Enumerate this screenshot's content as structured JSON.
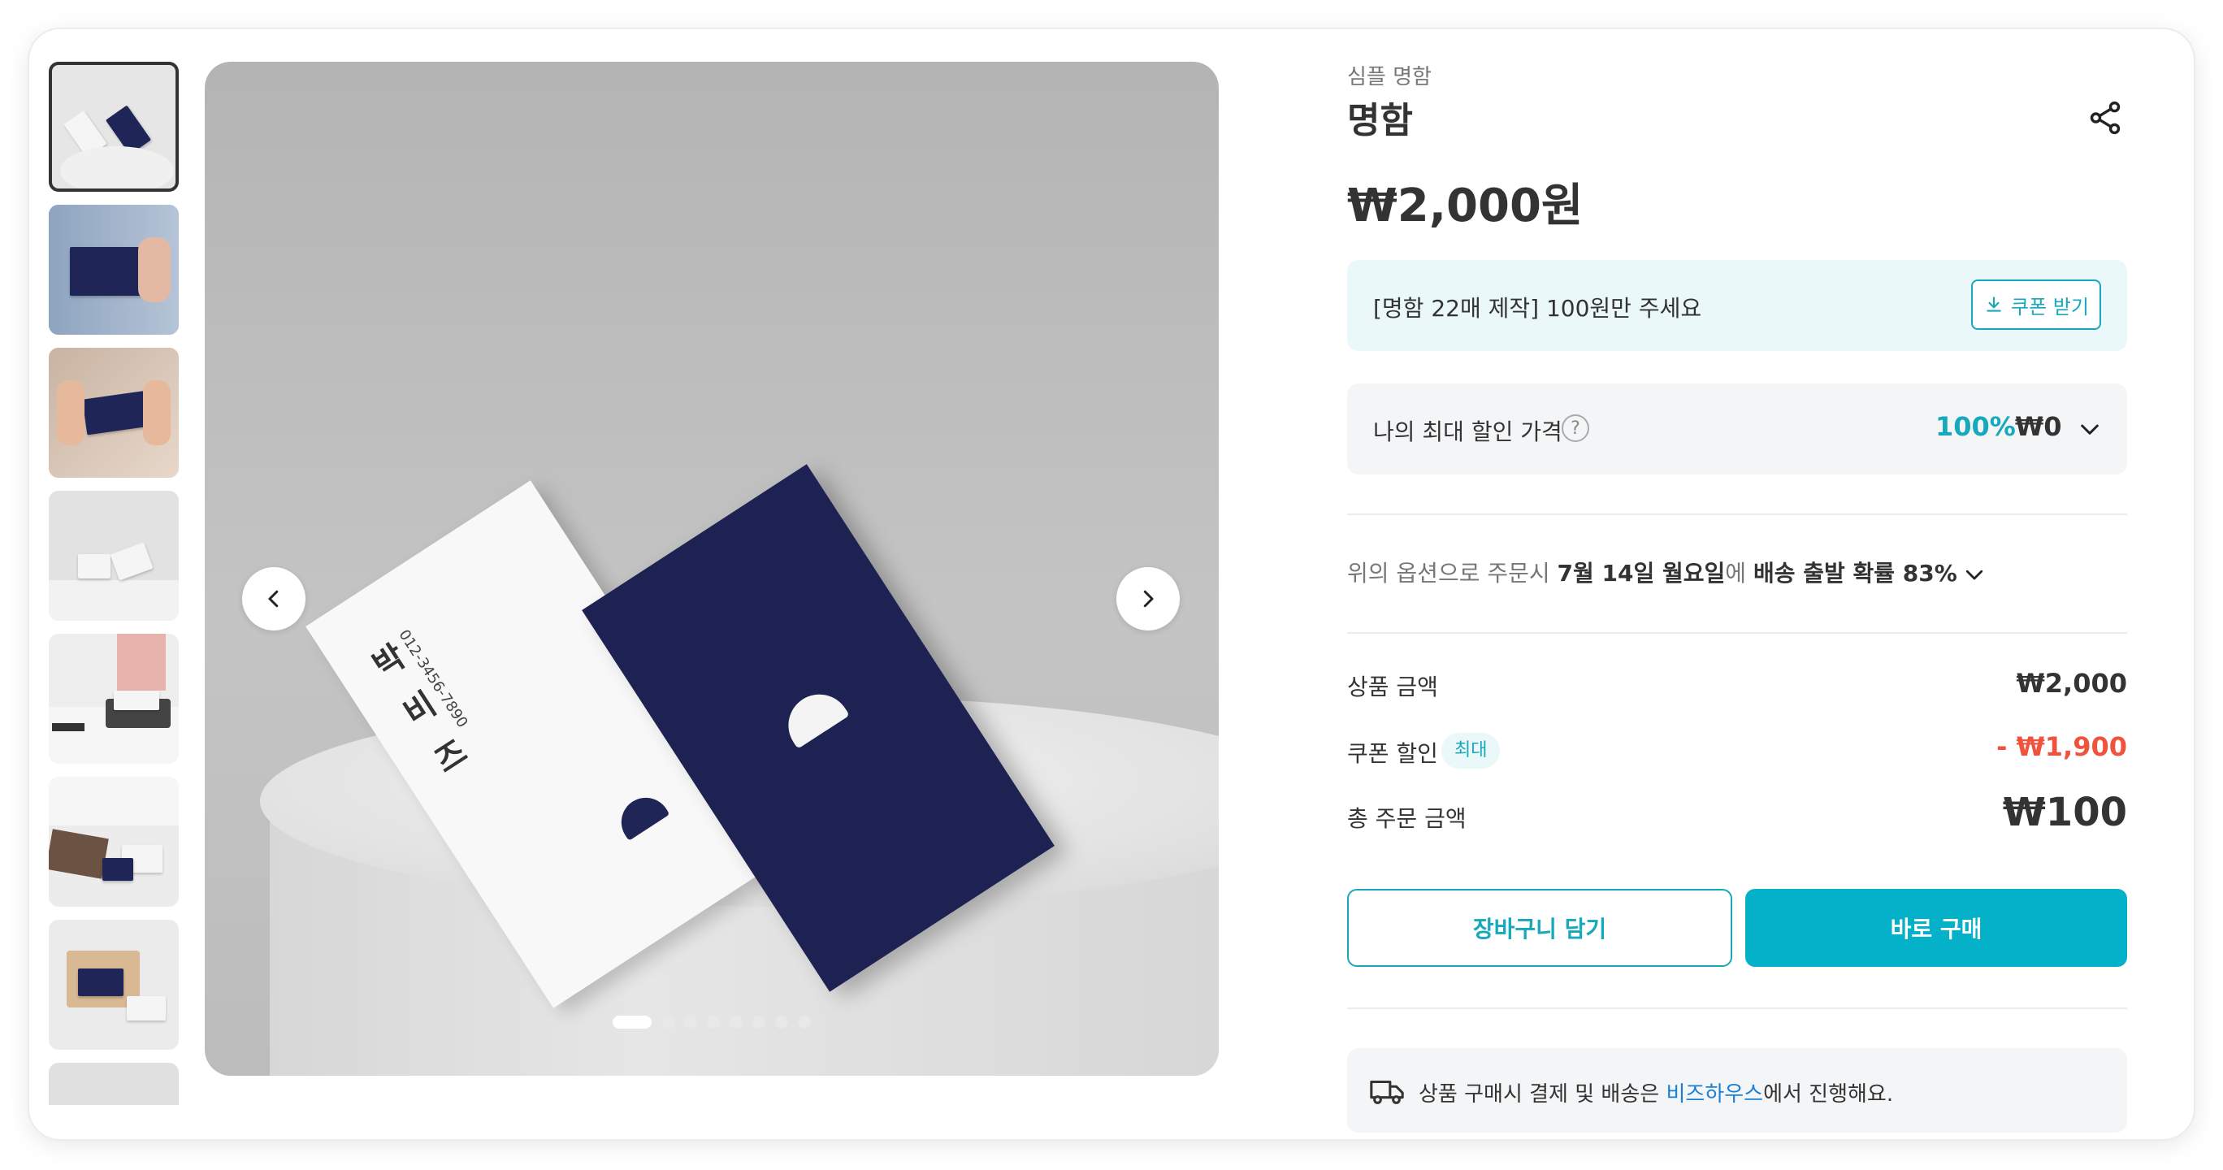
{
  "product": {
    "category": "심플 명함",
    "title": "명함",
    "price": "₩2,000원"
  },
  "coupon_banner": {
    "text": "[명함 22매 제작] 100원만 주세요",
    "button_label": "쿠폰 받기"
  },
  "max_discount": {
    "label": "나의 최대 할인 가격",
    "help": "?",
    "percent": "100%",
    "price": "₩0"
  },
  "shipping": {
    "prefix": "위의 옵션으로 주문시 ",
    "date": "7월 14일 월요일",
    "mid": "에 ",
    "probability": "배송 출발 확률 83%"
  },
  "summary": {
    "product_amount_label": "상품 금액",
    "product_amount": "₩2,000",
    "coupon_label": "쿠폰 할인",
    "coupon_badge": "최대",
    "coupon_amount": "- ₩1,900",
    "total_label": "총 주문 금액",
    "total_amount": "₩100"
  },
  "buttons": {
    "cart": "장바구니 담기",
    "buy": "바로 구매"
  },
  "notice": {
    "prefix": "상품 구매시 결제 및 배송은 ",
    "link": "비즈하우스",
    "suffix": "에서 진행해요."
  },
  "main_image_card": {
    "name": "박 비 즈",
    "phone": "012-3456-7890"
  },
  "gallery": {
    "total_images": 8,
    "active_index": 0
  },
  "colors": {
    "accent": "#04b1c8",
    "accent_text": "#16a8bb",
    "discount_red": "#f0533d",
    "navy_card": "#1e2252",
    "link_blue": "#1a7fd6"
  }
}
